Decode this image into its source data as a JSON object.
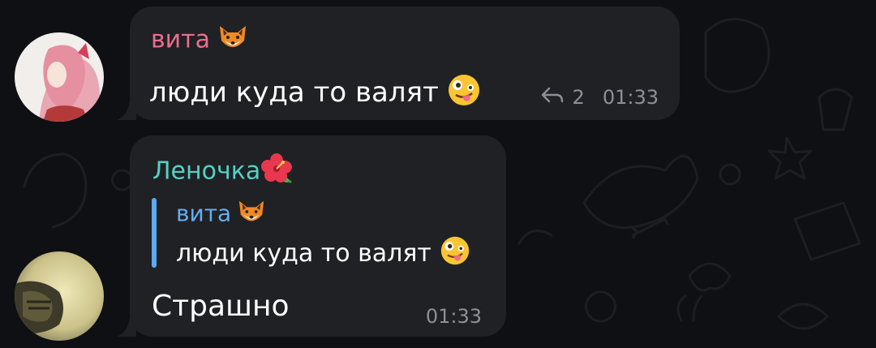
{
  "chat": {
    "messages": [
      {
        "sender": "вита",
        "sender_emoji": "fox-face",
        "text": "люди куда то валят",
        "text_emoji": "zany-face",
        "reply_count": "2",
        "time": "01:33"
      },
      {
        "sender": "Леночка",
        "sender_emoji": "hibiscus",
        "quote": {
          "sender": "вита",
          "sender_emoji": "fox-face",
          "text": "люди куда то валят",
          "text_emoji": "zany-face"
        },
        "text": "Страшно",
        "time": "01:33"
      }
    ]
  },
  "colors": {
    "background": "#0f1013",
    "bubble": "#202124",
    "sender1": "#ee6d8f",
    "sender2": "#52d3c6",
    "quote_accent": "#5ea9ef",
    "meta": "#8d9095"
  }
}
